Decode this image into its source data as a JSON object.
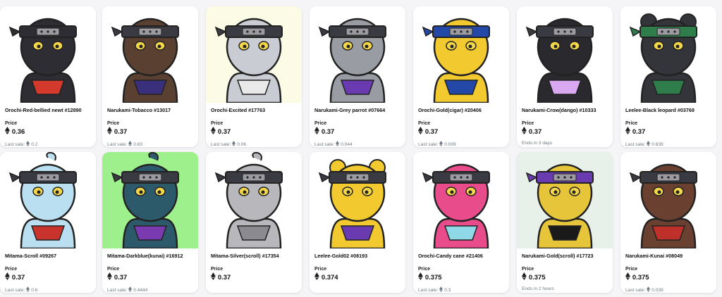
{
  "cards": [
    {
      "name": "Orochi-Red-bellied newt #12890",
      "price_label": "Price",
      "price": "0.36",
      "footer_label": "Last sale:",
      "footer_value": "0.2",
      "icon": "newt-avatar",
      "bg": "#ffffff",
      "body": "#2d2d33",
      "accent": "#d33a2c",
      "band": "#2d2d33"
    },
    {
      "name": "Narukami-Tobacco #13017",
      "price_label": "Price",
      "price": "0.37",
      "footer_label": "Last sale:",
      "footer_value": "0.83",
      "icon": "bird-avatar",
      "bg": "#ffffff",
      "body": "#5a4030",
      "accent": "#3a2f7a",
      "band": "#3a3a42"
    },
    {
      "name": "Orochi-Excited #17763",
      "price_label": "Price",
      "price": "0.37",
      "footer_label": "Last sale:",
      "footer_value": "0.06",
      "icon": "snake-avatar",
      "bg": "#fbfbe6",
      "body": "#c9cdd3",
      "accent": "#e9e9e9",
      "band": "#3a3a42"
    },
    {
      "name": "Narukami-Grey parrot #07664",
      "price_label": "Price",
      "price": "0.37",
      "footer_label": "Last sale:",
      "footer_value": "0.044",
      "icon": "parrot-avatar",
      "bg": "#ffffff",
      "body": "#9a9ca3",
      "accent": "#6a3ab0",
      "band": "#3a3a42"
    },
    {
      "name": "Orochi-Gold(cigar) #20406",
      "price_label": "Price",
      "price": "0.37",
      "footer_label": "Last sale:",
      "footer_value": "0.009",
      "icon": "snake-avatar",
      "bg": "#ffffff",
      "body": "#f2c92e",
      "accent": "#2448a8",
      "band": "#2448a8"
    },
    {
      "name": "Narukami-Crow(dango) #10333",
      "price_label": "Price",
      "price": "0.37",
      "footer_label": "Ends in 3 days",
      "footer_value": "",
      "icon": "crow-avatar",
      "bg": "#ffffff",
      "body": "#2a2a2e",
      "accent": "#d8a8f0",
      "band": "#3a3a42"
    },
    {
      "name": "Leelee-Black leopard #03769",
      "price_label": "Price",
      "price": "0.37",
      "footer_label": "Last sale:",
      "footer_value": "0.639",
      "icon": "leopard-avatar",
      "bg": "#ffffff",
      "body": "#33353a",
      "accent": "#2e7d4a",
      "band": "#2e7d4a"
    },
    {
      "name": "Mitama-Scroll #09267",
      "price_label": "Price",
      "price": "0.37",
      "footer_label": "Last sale:",
      "footer_value": "0.6",
      "icon": "ghost-avatar",
      "bg": "#ffffff",
      "body": "#b9dff0",
      "accent": "#c8332b",
      "band": "#3a3a42"
    },
    {
      "name": "Mitama-Darkblue(kunai) #16912",
      "price_label": "Price",
      "price": "0.37",
      "footer_label": "Last sale:",
      "footer_value": "0.4444",
      "icon": "ghost-avatar",
      "bg": "#9ef08c",
      "body": "#2d5a6a",
      "accent": "#7a3ab0",
      "band": "#3a3a42"
    },
    {
      "name": "Mitama-Silver(scroll) #17354",
      "price_label": "Price",
      "price": "0.37",
      "footer_label": "",
      "footer_value": "",
      "icon": "ghost-avatar",
      "bg": "#ffffff",
      "body": "#b8b8bc",
      "accent": "#8a8a90",
      "band": "#3a3a42"
    },
    {
      "name": "Leelee-Gold02 #08193",
      "price_label": "Price",
      "price": "0.374",
      "footer_label": "",
      "footer_value": "",
      "icon": "bear-avatar",
      "bg": "#ffffff",
      "body": "#f2c92e",
      "accent": "#6a3ab0",
      "band": "#3a3a42"
    },
    {
      "name": "Orochi-Candy cane #21406",
      "price_label": "Price",
      "price": "0.375",
      "footer_label": "Last sale:",
      "footer_value": "0.3",
      "icon": "snake-avatar",
      "bg": "#ffffff",
      "body": "#e84c8a",
      "accent": "#8fd8e8",
      "band": "#3a3a42"
    },
    {
      "name": "Narukami-Gold(scroll) #17723",
      "price_label": "Price",
      "price": "0.375",
      "footer_label": "Ends in 2 hours",
      "footer_value": "",
      "icon": "bird-avatar",
      "bg": "#e8f0ea",
      "body": "#e6c53a",
      "accent": "#1a1a1a",
      "band": "#6a3ab0"
    },
    {
      "name": "Narukami-Kunai #08049",
      "price_label": "Price",
      "price": "0.375",
      "footer_label": "Last sale:",
      "footer_value": "0.039",
      "icon": "bird-avatar",
      "bg": "#ffffff",
      "body": "#6a4030",
      "accent": "#c0302a",
      "band": "#3a3a42"
    }
  ]
}
